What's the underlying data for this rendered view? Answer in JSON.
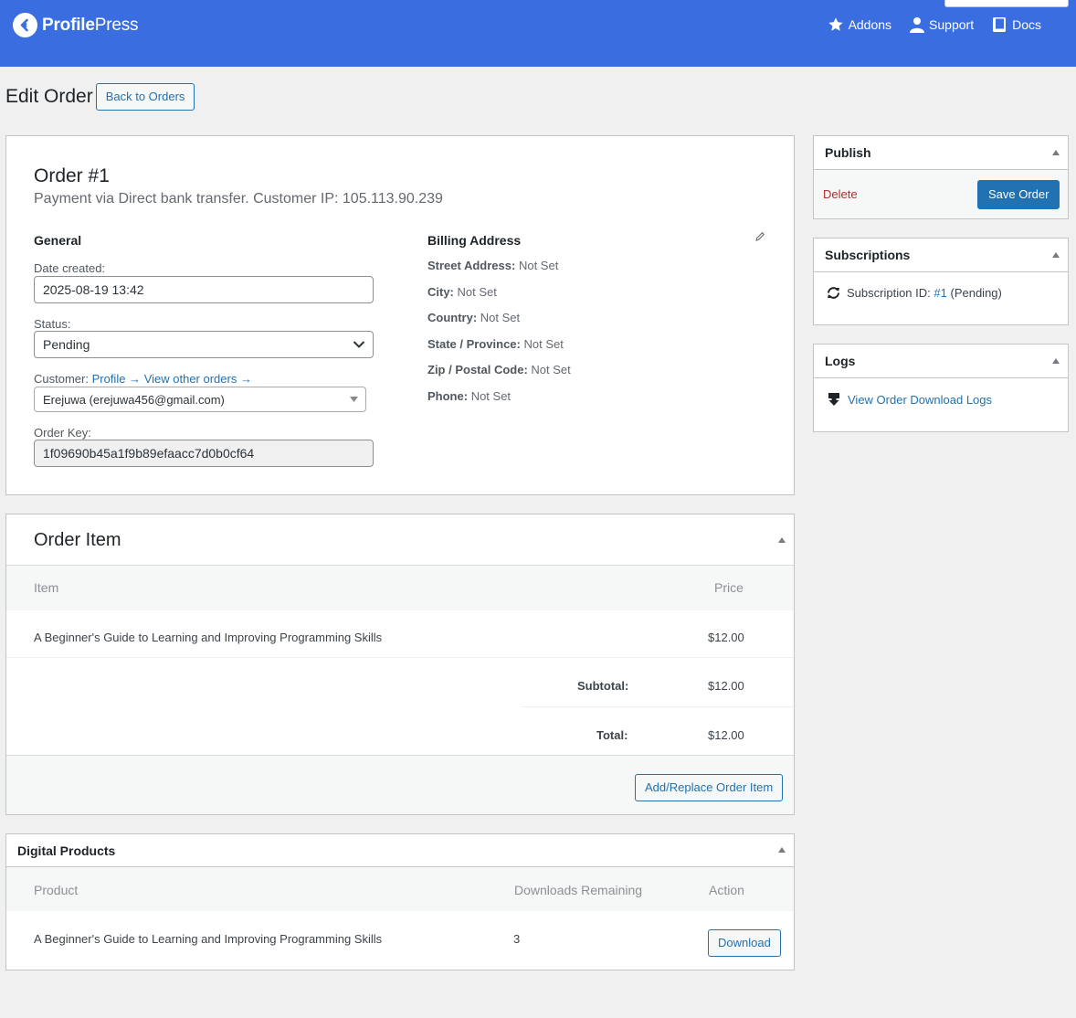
{
  "header": {
    "brand_bold": "Profile",
    "brand_light": "Press",
    "nav": [
      {
        "label": "Addons",
        "icon": "star-icon"
      },
      {
        "label": "Support",
        "icon": "user-icon"
      },
      {
        "label": "Docs",
        "icon": "book-icon"
      }
    ],
    "accent": "#3a6de0"
  },
  "page": {
    "title": "Edit Order",
    "back_button": "Back to Orders"
  },
  "order": {
    "title": "Order #1",
    "subtitle": "Payment via Direct bank transfer. Customer IP: 105.113.90.239",
    "general": {
      "heading": "General",
      "date_label": "Date created:",
      "date_value": "2025-08-19 13:42",
      "status_label": "Status:",
      "status_value": "Pending",
      "customer_label": "Customer:",
      "profile_link": "Profile →",
      "other_orders_link": "View other orders →",
      "customer_value": "Erejuwa (erejuwa456@gmail.com)",
      "key_label": "Order Key:",
      "key_value": "1f09690b45a1f9b89efaacc7d0b0cf64"
    },
    "billing": {
      "heading": "Billing Address",
      "rows": [
        {
          "label": "Street Address:",
          "value": "Not Set"
        },
        {
          "label": "City:",
          "value": "Not Set"
        },
        {
          "label": "Country:",
          "value": "Not Set"
        },
        {
          "label": "State / Province:",
          "value": "Not Set"
        },
        {
          "label": "Zip / Postal Code:",
          "value": "Not Set"
        },
        {
          "label": "Phone:",
          "value": "Not Set"
        }
      ]
    }
  },
  "order_item": {
    "title": "Order Item",
    "col_item": "Item",
    "col_price": "Price",
    "item_name": "A Beginner's Guide to Learning and Improving Programming Skills",
    "item_price": "$12.00",
    "subtotal_label": "Subtotal:",
    "subtotal_value": "$12.00",
    "total_label": "Total:",
    "total_value": "$12.00",
    "add_button": "Add/Replace Order Item"
  },
  "digital_products": {
    "title": "Digital Products",
    "col_product": "Product",
    "col_downloads": "Downloads Remaining",
    "col_action": "Action",
    "product_name": "A Beginner's Guide to Learning and Improving Programming Skills",
    "downloads_remaining": "3",
    "download_button": "Download"
  },
  "sidebar": {
    "publish": {
      "title": "Publish",
      "delete": "Delete",
      "save": "Save Order"
    },
    "subscriptions": {
      "title": "Subscriptions",
      "label": "Subscription ID:",
      "id_link": "#1",
      "status": "(Pending)"
    },
    "logs": {
      "title": "Logs",
      "link": "View Order Download Logs"
    }
  }
}
